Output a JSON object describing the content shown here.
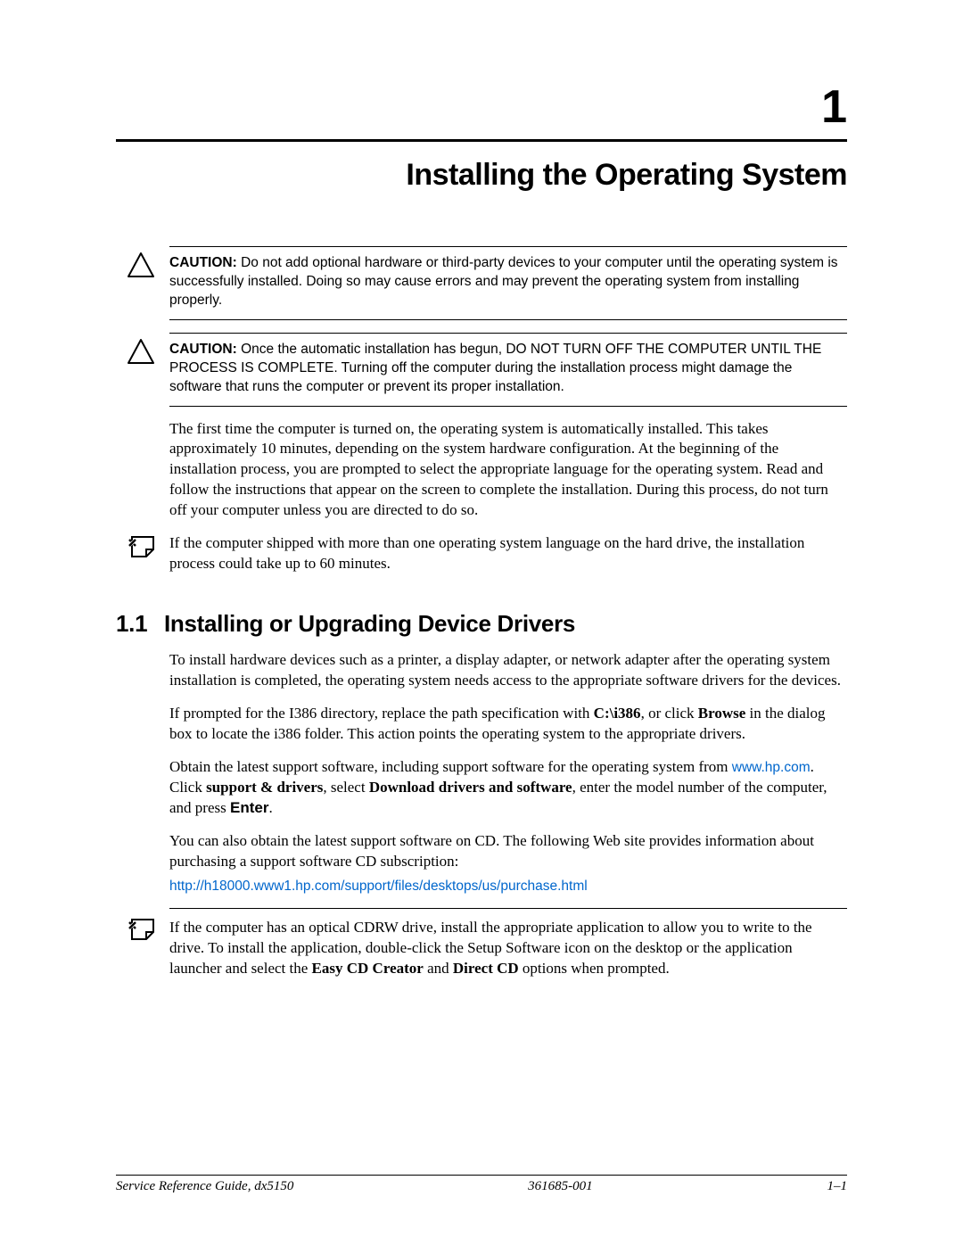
{
  "chapter": {
    "number": "1",
    "title": "Installing the Operating System"
  },
  "caution1": {
    "label": "CAUTION:",
    "text": " Do not add optional hardware or third-party devices to your computer until the operating system is successfully installed. Doing so may cause errors and may prevent the operating system from installing properly."
  },
  "caution2": {
    "label": "CAUTION:",
    "text": " Once the automatic installation has begun, DO NOT TURN OFF THE COMPUTER UNTIL THE PROCESS IS COMPLETE. Turning off the computer during the installation process might damage the software that runs the computer or prevent its proper installation."
  },
  "para1": "The first time the computer is turned on, the operating system is automatically installed. This takes approximately 10 minutes, depending on the system hardware configuration. At the beginning of the installation process, you are prompted to select the appropriate language for the operating system. Read and follow the instructions that appear on the screen to complete the installation. During this process, do not turn off your computer unless you are directed to do so.",
  "note1": "If the computer shipped with more than one operating system language on the hard drive, the installation process could take up to 60 minutes.",
  "section1": {
    "number": "1.1",
    "title": "Installing or Upgrading Device Drivers"
  },
  "para2": "To install hardware devices such as a printer, a display adapter, or network adapter after the operating system installation is completed, the operating system needs access to the appropriate software drivers for the devices.",
  "para3": {
    "t1": "If prompted for the I386 directory, replace the path specification with ",
    "b1": "C:\\i386",
    "t2": ", or click ",
    "b2": "Browse",
    "t3": " in the dialog box to locate the i386 folder. This action points the operating system to the appropriate drivers."
  },
  "para4": {
    "t1": "Obtain the latest support software, including support software for the operating system from ",
    "link1": "www.hp.com",
    "t2": ". Click ",
    "b1": "support & drivers",
    "t3": ", select ",
    "b2": "Download drivers and software",
    "t4": ", enter the model number of the computer, and press ",
    "b3": "Enter",
    "t5": "."
  },
  "para5": "You can also obtain the latest support software on CD. The following Web site provides information about purchasing a support software CD subscription:",
  "link2": "http://h18000.www1.hp.com/support/files/desktops/us/purchase.html",
  "note2": {
    "t1": "If the computer has an optical CDRW drive, install the appropriate application to allow you to write to the drive. To install the application, double-click the Setup Software icon on the desktop or the application launcher and select the ",
    "b1": "Easy CD Creator",
    "t2": " and ",
    "b2": "Direct CD",
    "t3": " options when prompted."
  },
  "footer": {
    "left": "Service Reference Guide, dx5150",
    "center": "361685-001",
    "right": "1–1"
  }
}
